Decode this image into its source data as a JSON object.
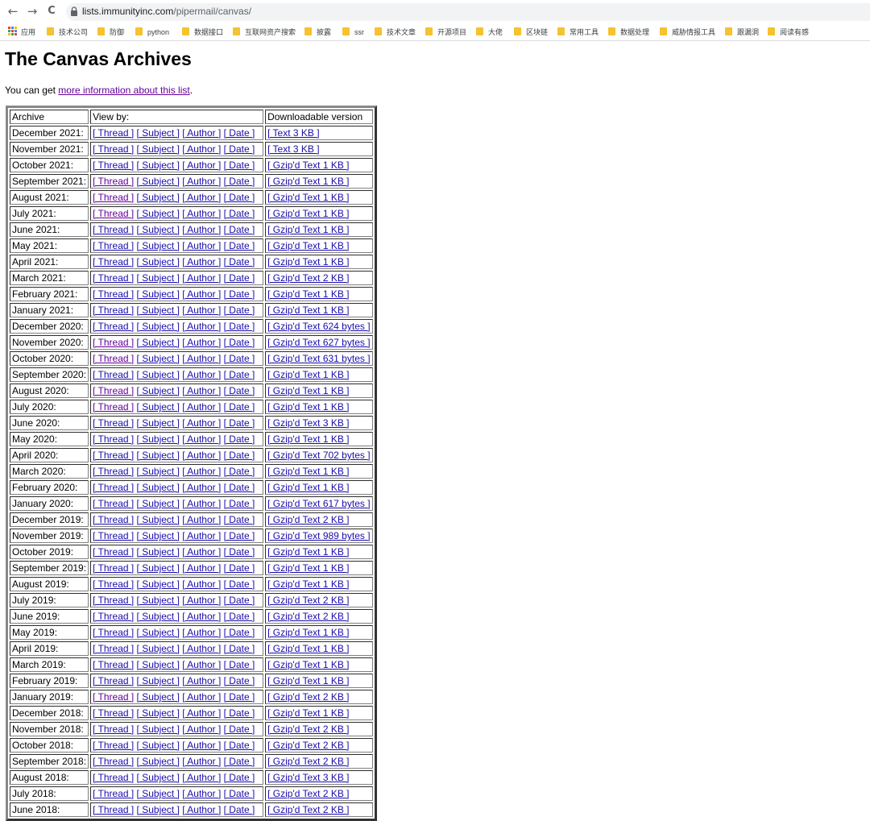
{
  "browser": {
    "back_glyph": "←",
    "forward_glyph": "→",
    "reload_glyph": "C",
    "url_host": "lists.immunityinc.com",
    "url_path": "/pipermail/canvas/"
  },
  "bookmarks": [
    "应用",
    "技术公司",
    "防御",
    "python",
    "数据接口",
    "互联网资产搜索",
    "披露",
    "ssr",
    "技术文章",
    "开源项目",
    "大佬",
    "区块链",
    "常用工具",
    "数据处理",
    "威胁情报工具",
    "跟漏洞",
    "阅读有感"
  ],
  "page": {
    "title": "The Canvas Archives",
    "intro_prefix": "You can get ",
    "intro_link": "more information about this list",
    "intro_suffix": "."
  },
  "table": {
    "headers": [
      "Archive",
      "View by:",
      "Downloadable version"
    ],
    "link_labels": {
      "thread": "[ Thread ]",
      "subject": "[ Subject ]",
      "author": "[ Author ]",
      "date": "[ Date ]"
    },
    "rows": [
      {
        "archive": "December 2021:",
        "download": "[ Text 3 KB ]"
      },
      {
        "archive": "November 2021:",
        "download": "[ Text 3 KB ]"
      },
      {
        "archive": "October 2021:",
        "download": "[ Gzip'd Text 1 KB ]"
      },
      {
        "archive": "September 2021:",
        "download": "[ Gzip'd Text 1 KB ]"
      },
      {
        "archive": "August 2021:",
        "download": "[ Gzip'd Text 1 KB ]"
      },
      {
        "archive": "July 2021:",
        "download": "[ Gzip'd Text 1 KB ]"
      },
      {
        "archive": "June 2021:",
        "download": "[ Gzip'd Text 1 KB ]"
      },
      {
        "archive": "May 2021:",
        "download": "[ Gzip'd Text 1 KB ]"
      },
      {
        "archive": "April 2021:",
        "download": "[ Gzip'd Text 1 KB ]"
      },
      {
        "archive": "March 2021:",
        "download": "[ Gzip'd Text 2 KB ]"
      },
      {
        "archive": "February 2021:",
        "download": "[ Gzip'd Text 1 KB ]"
      },
      {
        "archive": "January 2021:",
        "download": "[ Gzip'd Text 1 KB ]"
      },
      {
        "archive": "December 2020:",
        "download": "[ Gzip'd Text 624 bytes ]"
      },
      {
        "archive": "November 2020:",
        "download": "[ Gzip'd Text 627 bytes ]"
      },
      {
        "archive": "October 2020:",
        "download": "[ Gzip'd Text 631 bytes ]"
      },
      {
        "archive": "September 2020:",
        "download": "[ Gzip'd Text 1 KB ]"
      },
      {
        "archive": "August 2020:",
        "download": "[ Gzip'd Text 1 KB ]"
      },
      {
        "archive": "July 2020:",
        "download": "[ Gzip'd Text 1 KB ]"
      },
      {
        "archive": "June 2020:",
        "download": "[ Gzip'd Text 3 KB ]"
      },
      {
        "archive": "May 2020:",
        "download": "[ Gzip'd Text 1 KB ]"
      },
      {
        "archive": "April 2020:",
        "download": "[ Gzip'd Text 702 bytes ]"
      },
      {
        "archive": "March 2020:",
        "download": "[ Gzip'd Text 1 KB ]"
      },
      {
        "archive": "February 2020:",
        "download": "[ Gzip'd Text 1 KB ]"
      },
      {
        "archive": "January 2020:",
        "download": "[ Gzip'd Text 617 bytes ]"
      },
      {
        "archive": "December 2019:",
        "download": "[ Gzip'd Text 2 KB ]"
      },
      {
        "archive": "November 2019:",
        "download": "[ Gzip'd Text 989 bytes ]"
      },
      {
        "archive": "October 2019:",
        "download": "[ Gzip'd Text 1 KB ]"
      },
      {
        "archive": "September 2019:",
        "download": "[ Gzip'd Text 1 KB ]"
      },
      {
        "archive": "August 2019:",
        "download": "[ Gzip'd Text 1 KB ]"
      },
      {
        "archive": "July 2019:",
        "download": "[ Gzip'd Text 2 KB ]"
      },
      {
        "archive": "June 2019:",
        "download": "[ Gzip'd Text 2 KB ]"
      },
      {
        "archive": "May 2019:",
        "download": "[ Gzip'd Text 1 KB ]"
      },
      {
        "archive": "April 2019:",
        "download": "[ Gzip'd Text 1 KB ]"
      },
      {
        "archive": "March 2019:",
        "download": "[ Gzip'd Text 1 KB ]"
      },
      {
        "archive": "February 2019:",
        "download": "[ Gzip'd Text 1 KB ]"
      },
      {
        "archive": "January 2019:",
        "download": "[ Gzip'd Text 2 KB ]"
      },
      {
        "archive": "December 2018:",
        "download": "[ Gzip'd Text 1 KB ]"
      },
      {
        "archive": "November 2018:",
        "download": "[ Gzip'd Text 2 KB ]"
      },
      {
        "archive": "October 2018:",
        "download": "[ Gzip'd Text 2 KB ]"
      },
      {
        "archive": "September 2018:",
        "download": "[ Gzip'd Text 2 KB ]"
      },
      {
        "archive": "August 2018:",
        "download": "[ Gzip'd Text 3 KB ]"
      },
      {
        "archive": "July 2018:",
        "download": "[ Gzip'd Text 2 KB ]"
      },
      {
        "archive": "June 2018:",
        "download": "[ Gzip'd Text 2 KB ]"
      }
    ]
  },
  "colors": {
    "link": "#1a0dab",
    "visited": "#660099",
    "folder": "#f5c230"
  }
}
